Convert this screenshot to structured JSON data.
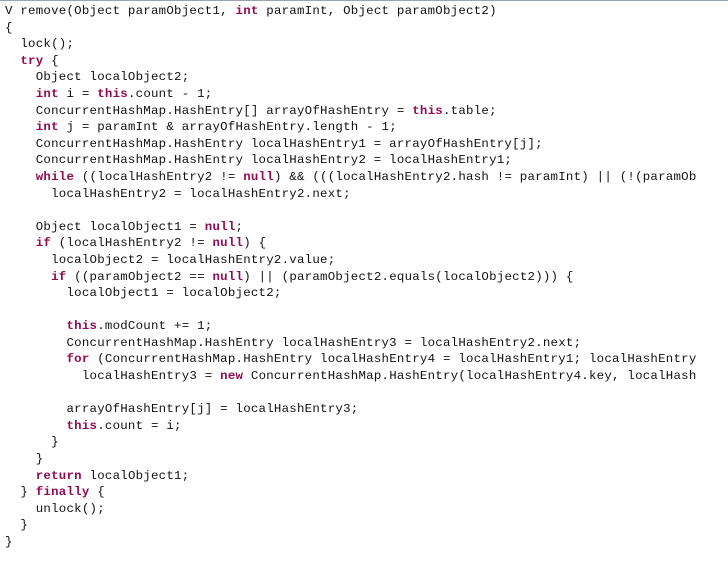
{
  "view": {
    "kind": "code-listing",
    "language": "java",
    "background_color": "#ffffff",
    "text_color": "#111111",
    "keyword_color": "#8f0b52",
    "top_border_color": "#9aa4b0",
    "wrap": false,
    "right_clipped": true
  },
  "code": {
    "lines": [
      {
        "n": 1,
        "text": "V remove(Object paramObject1, int paramInt, Object paramObject2)",
        "keywords": [
          "int"
        ]
      },
      {
        "n": 2,
        "text": "{",
        "keywords": []
      },
      {
        "n": 3,
        "text": "  lock();",
        "keywords": []
      },
      {
        "n": 4,
        "text": "  try {",
        "keywords": [
          "try"
        ]
      },
      {
        "n": 5,
        "text": "    Object localObject2;",
        "keywords": []
      },
      {
        "n": 6,
        "text": "    int i = this.count - 1;",
        "keywords": [
          "int",
          "this"
        ]
      },
      {
        "n": 7,
        "text": "    ConcurrentHashMap.HashEntry[] arrayOfHashEntry = this.table;",
        "keywords": [
          "this"
        ]
      },
      {
        "n": 8,
        "text": "    int j = paramInt & arrayOfHashEntry.length - 1;",
        "keywords": [
          "int"
        ]
      },
      {
        "n": 9,
        "text": "    ConcurrentHashMap.HashEntry localHashEntry1 = arrayOfHashEntry[j];",
        "keywords": []
      },
      {
        "n": 10,
        "text": "    ConcurrentHashMap.HashEntry localHashEntry2 = localHashEntry1;",
        "keywords": []
      },
      {
        "n": 11,
        "text": "    while ((localHashEntry2 != null) && (((localHashEntry2.hash != paramInt) || (!(paramOb",
        "keywords": [
          "while",
          "null"
        ]
      },
      {
        "n": 12,
        "text": "      localHashEntry2 = localHashEntry2.next;",
        "keywords": []
      },
      {
        "n": 13,
        "text": "",
        "keywords": []
      },
      {
        "n": 14,
        "text": "    Object localObject1 = null;",
        "keywords": [
          "null"
        ]
      },
      {
        "n": 15,
        "text": "    if (localHashEntry2 != null) {",
        "keywords": [
          "if",
          "null"
        ]
      },
      {
        "n": 16,
        "text": "      localObject2 = localHashEntry2.value;",
        "keywords": []
      },
      {
        "n": 17,
        "text": "      if ((paramObject2 == null) || (paramObject2.equals(localObject2))) {",
        "keywords": [
          "if",
          "null"
        ]
      },
      {
        "n": 18,
        "text": "        localObject1 = localObject2;",
        "keywords": []
      },
      {
        "n": 19,
        "text": "",
        "keywords": []
      },
      {
        "n": 20,
        "text": "        this.modCount += 1;",
        "keywords": [
          "this"
        ]
      },
      {
        "n": 21,
        "text": "        ConcurrentHashMap.HashEntry localHashEntry3 = localHashEntry2.next;",
        "keywords": []
      },
      {
        "n": 22,
        "text": "        for (ConcurrentHashMap.HashEntry localHashEntry4 = localHashEntry1; localHashEntry",
        "keywords": [
          "for"
        ]
      },
      {
        "n": 23,
        "text": "          localHashEntry3 = new ConcurrentHashMap.HashEntry(localHashEntry4.key, localHash",
        "keywords": [
          "new"
        ]
      },
      {
        "n": 24,
        "text": "",
        "keywords": []
      },
      {
        "n": 25,
        "text": "        arrayOfHashEntry[j] = localHashEntry3;",
        "keywords": []
      },
      {
        "n": 26,
        "text": "        this.count = i;",
        "keywords": [
          "this"
        ]
      },
      {
        "n": 27,
        "text": "      }",
        "keywords": []
      },
      {
        "n": 28,
        "text": "    }",
        "keywords": []
      },
      {
        "n": 29,
        "text": "    return localObject1;",
        "keywords": [
          "return"
        ]
      },
      {
        "n": 30,
        "text": "  } finally {",
        "keywords": [
          "finally"
        ]
      },
      {
        "n": 31,
        "text": "    unlock();",
        "keywords": []
      },
      {
        "n": 32,
        "text": "  }",
        "keywords": []
      },
      {
        "n": 33,
        "text": "}",
        "keywords": []
      }
    ]
  }
}
